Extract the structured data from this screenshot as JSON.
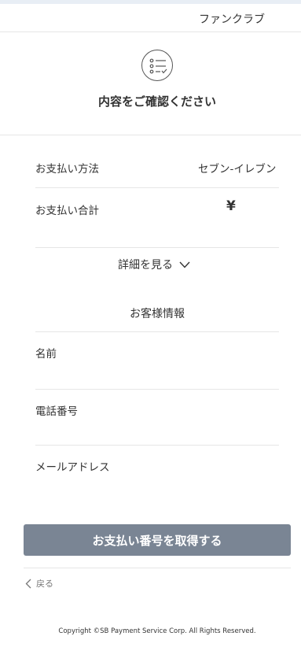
{
  "header": {
    "shop_name": "ファンクラブ"
  },
  "page": {
    "icon": "checklist-icon",
    "title": "内容をご確認ください"
  },
  "payment_summary": {
    "method_label": "お支払い方法",
    "method_value": "セブン-イレブン",
    "total_label": "お支払い合計",
    "total_value": "¥",
    "details_toggle_label": "詳細を見る",
    "details_toggle_icon": "chevron-down-icon"
  },
  "customer_info": {
    "section_title": "お客様情報",
    "fields": [
      {
        "label": "名前",
        "value": ""
      },
      {
        "label": "電話番号",
        "value": ""
      },
      {
        "label": "メールアドレス",
        "value": ""
      }
    ]
  },
  "actions": {
    "submit_label": "お支払い番号を取得する",
    "back_label": "戻る",
    "back_icon": "chevron-left-icon"
  },
  "footer": {
    "copyright": "Copyright ©SB Payment Service Corp. All Rights Reserved."
  },
  "colors": {
    "button_bg": "#7a8594",
    "divider": "#e6e6e6",
    "top_strip": "#e8eef5"
  }
}
